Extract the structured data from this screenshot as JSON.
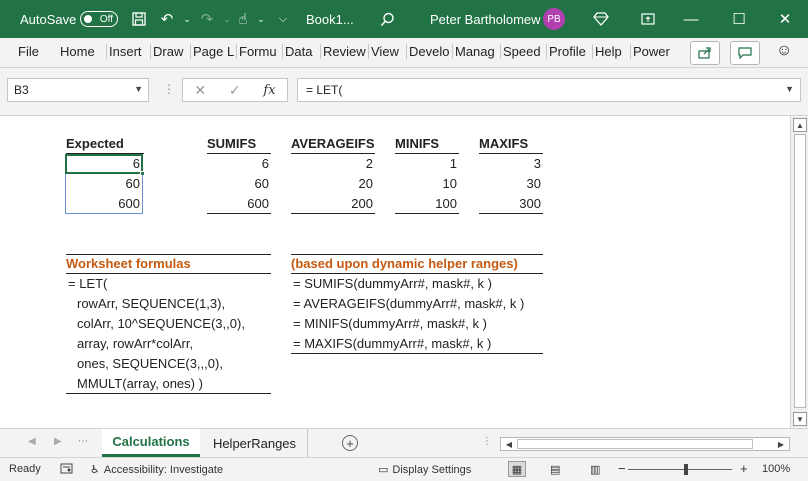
{
  "titlebar": {
    "autosave_label": "AutoSave",
    "autosave_state": "Off",
    "document_title": "Book1...",
    "user_name": "Peter Bartholomew",
    "user_initials": "PB",
    "save_icon": "save-icon",
    "colors": {
      "bar": "#217346",
      "avatar": "#b23fb0"
    }
  },
  "ribbon": {
    "tabs": [
      "File",
      "Home",
      "Insert",
      "Draw",
      "Page L",
      "Formu",
      "Data",
      "Review",
      "View",
      "Develo",
      "Manag",
      "Speed",
      "Profile",
      "Help",
      "Power"
    ]
  },
  "formula_bar": {
    "name_box": "B3",
    "fx_label": "fx",
    "formula": "= LET("
  },
  "sheet": {
    "expected": {
      "header": "Expected",
      "values": [
        "6",
        "60",
        "600"
      ]
    },
    "sumifs": {
      "header": "SUMIFS",
      "values": [
        "6",
        "60",
        "600"
      ]
    },
    "averageifs": {
      "header": "AVERAGEIFS",
      "values": [
        "2",
        "20",
        "200"
      ]
    },
    "minifs": {
      "header": "MINIFS",
      "values": [
        "1",
        "10",
        "100"
      ]
    },
    "maxifs": {
      "header": "MAXIFS",
      "values": [
        "3",
        "30",
        "300"
      ]
    },
    "worksheet_formulas": {
      "header": "Worksheet formulas",
      "lines": [
        "= LET(",
        "rowArr, SEQUENCE(1,3),",
        "colArr, 10^SEQUENCE(3,,0),",
        "array, rowArr*colArr,",
        "ones, SEQUENCE(3,,,0),",
        "MMULT(array, ones) )"
      ]
    },
    "helper_formulas": {
      "header": "(based upon dynamic helper ranges)",
      "lines": [
        "= SUMIFS(dummyArr#, mask#, k )",
        "= AVERAGEIFS(dummyArr#, mask#, k )",
        "= MINIFS(dummyArr#, mask#, k )",
        "= MAXIFS(dummyArr#, mask#, k )"
      ]
    },
    "colors": {
      "orange_text": "#c55a11",
      "selection": "#217346"
    }
  },
  "sheet_tabs": {
    "tabs": [
      "Calculations",
      "HelperRanges"
    ],
    "active": "Calculations"
  },
  "status_bar": {
    "ready": "Ready",
    "accessibility": "Accessibility: Investigate",
    "display_settings": "Display Settings",
    "zoom": "100%"
  }
}
